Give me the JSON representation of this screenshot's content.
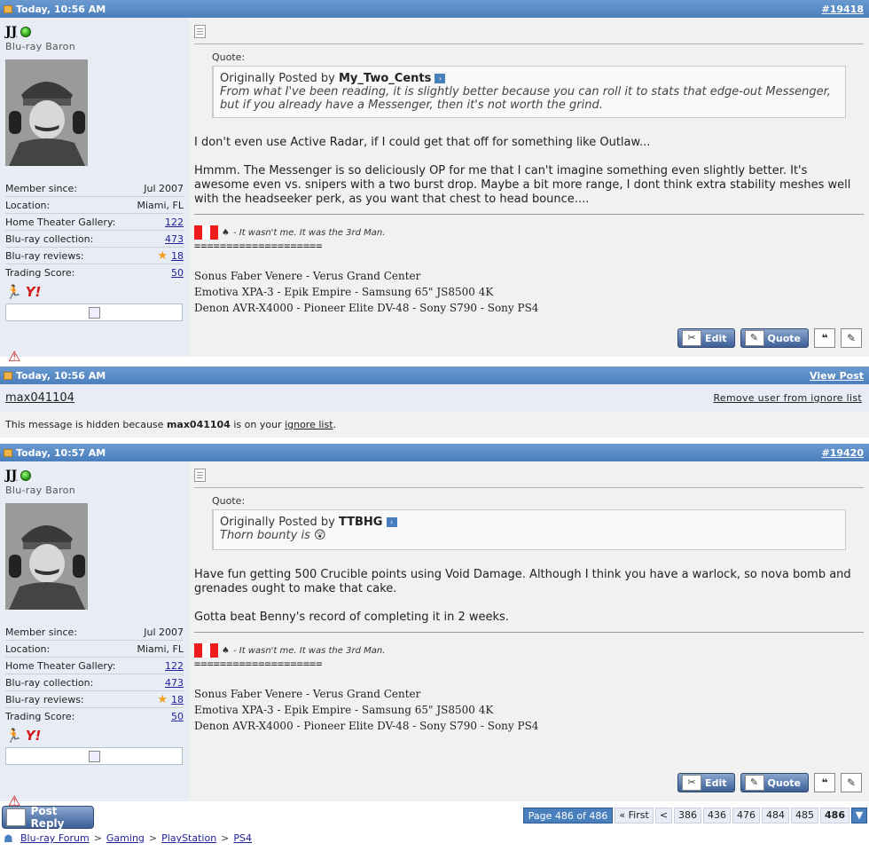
{
  "posts": [
    {
      "time": "Today, 10:56 AM",
      "number": "#19418",
      "user": {
        "name": "JJ",
        "title": "Blu-ray Baron",
        "stats": [
          {
            "label": "Member since:",
            "value": "Jul 2007",
            "link": false
          },
          {
            "label": "Location:",
            "value": "Miami, FL",
            "link": false
          },
          {
            "label": "Home Theater Gallery:",
            "value": "122",
            "link": true
          },
          {
            "label": "Blu-ray collection:",
            "value": "473",
            "link": true
          },
          {
            "label": "Blu-ray reviews:",
            "value": "18",
            "link": true
          },
          {
            "label": "Trading Score:",
            "value": "50",
            "link": true
          }
        ]
      },
      "quote": {
        "label": "Quote:",
        "prefix": "Originally Posted by",
        "author": "My_Two_Cents",
        "text": "From what I've been reading, it is slightly better because you can roll it to stats that edge-out Messenger, but if you already have a Messenger, then it's not worth the grind."
      },
      "paragraphs": [
        "I don't even use Active Radar, if I could get that off for something like Outlaw...",
        "Hmmm. The Messenger is so deliciously OP for me that I can't imagine something even slightly better. It's awesome even vs. snipers with a two burst drop. Maybe a bit more range, I dont think extra stability meshes well with the headseeker perk, as you want that chest to head bounce...."
      ]
    },
    {
      "time": "Today, 10:57 AM",
      "number": "#19420",
      "user": {
        "name": "JJ",
        "title": "Blu-ray Baron",
        "stats": [
          {
            "label": "Member since:",
            "value": "Jul 2007",
            "link": false
          },
          {
            "label": "Location:",
            "value": "Miami, FL",
            "link": false
          },
          {
            "label": "Home Theater Gallery:",
            "value": "122",
            "link": true
          },
          {
            "label": "Blu-ray collection:",
            "value": "473",
            "link": true
          },
          {
            "label": "Blu-ray reviews:",
            "value": "18",
            "link": true
          },
          {
            "label": "Trading Score:",
            "value": "50",
            "link": true
          }
        ]
      },
      "quote": {
        "label": "Quote:",
        "prefix": "Originally Posted by",
        "author": "TTBHG",
        "text": "Thorn bounty is"
      },
      "paragraphs": [
        "Have fun getting 500 Crucible points using Void Damage. Although I think you have a warlock, so nova bomb and grenades ought to make that cake.",
        "Gotta beat Benny's record of completing it in 2 weeks."
      ]
    }
  ],
  "signature": {
    "tagline": "- It wasn't me. It was the 3rd Man.",
    "divider": "====================",
    "gear": [
      "Sonus Faber Venere - Verus Grand Center",
      "Emotiva XPA-3 - Epik Empire - Samsung 65\" JS8500 4K",
      "Denon AVR-X4000 - Pioneer Elite DV-48 - Sony S790 - Sony PS4"
    ]
  },
  "buttons": {
    "edit": "Edit",
    "quote": "Quote"
  },
  "ignored": {
    "time": "Today, 10:56 AM",
    "view_post": "View Post",
    "username": "max041104",
    "remove": "Remove user from ignore list",
    "msg_prefix": "This message is hidden because",
    "msg_mid": "is on your",
    "msg_link": "ignore list",
    "msg_end": "."
  },
  "post_reply": "Post Reply",
  "pager": {
    "label": "Page 486 of 486",
    "first": "« First",
    "prev": "<",
    "pages": [
      "386",
      "436",
      "476",
      "484",
      "485"
    ],
    "current": "486"
  },
  "breadcrumb": [
    "Blu-ray Forum",
    "Gaming",
    "PlayStation",
    "PS4"
  ],
  "colors": {
    "header_blue": "#4a7fbd",
    "user_panel": "#e8ecf4",
    "content_bg": "#f1f1f1",
    "link": "#22229c"
  }
}
